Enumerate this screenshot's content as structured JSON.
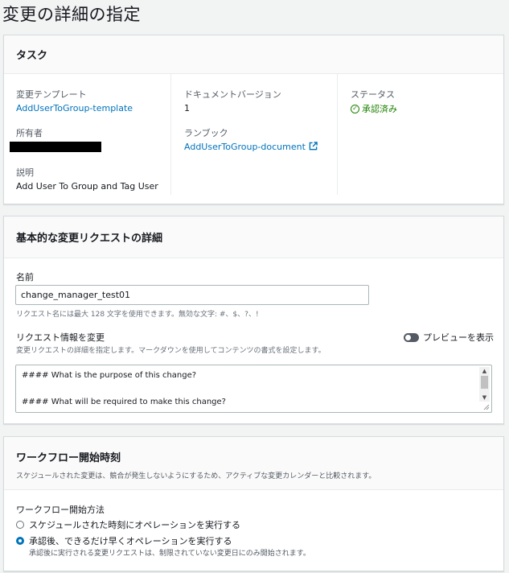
{
  "page": {
    "title": "変更の詳細の指定"
  },
  "task": {
    "title": "タスク",
    "template_label": "変更テンプレート",
    "template_value": "AddUserToGroup-template",
    "owner_label": "所有者",
    "description_label": "説明",
    "description_value": "Add User To Group and Tag User",
    "doc_version_label": "ドキュメントバージョン",
    "doc_version_value": "1",
    "runbook_label": "ランブック",
    "runbook_value": "AddUserToGroup-document",
    "status_label": "ステータス",
    "status_value": "承認済み",
    "status_color": "#1d8102"
  },
  "basic": {
    "title": "基本的な変更リクエストの詳細",
    "name_label": "名前",
    "name_value": "change_manager_test01",
    "name_hint": "リクエスト名には最大 128 文字を使用できます。無効な文字: #、$、?、!",
    "info_label": "リクエスト情報を変更",
    "info_hint": "変更リクエストの詳細を指定します。マークダウンを使用してコンテンツの書式を設定します。",
    "preview_toggle_label": "プレビューを表示",
    "textarea_lines": [
      "#### What is the purpose of this change?",
      "",
      "#### What will be required to make this change?"
    ]
  },
  "workflow": {
    "title": "ワークフロー開始時刻",
    "description": "スケジュールされた変更は、競合が発生しないようにするため、アクティブな変更カレンダーと比較されます。",
    "method_label": "ワークフロー開始方法",
    "options": [
      {
        "label": "スケジュールされた時刻にオペレーションを実行する",
        "selected": false
      },
      {
        "label": "承認後、できるだけ早くオペレーションを実行する",
        "selected": true,
        "sub": "承認後に実行される変更リクエストは、制限されていない変更日にのみ開始されます。"
      }
    ]
  },
  "colors": {
    "link": "#0073bb",
    "accent": "#0073bb"
  }
}
